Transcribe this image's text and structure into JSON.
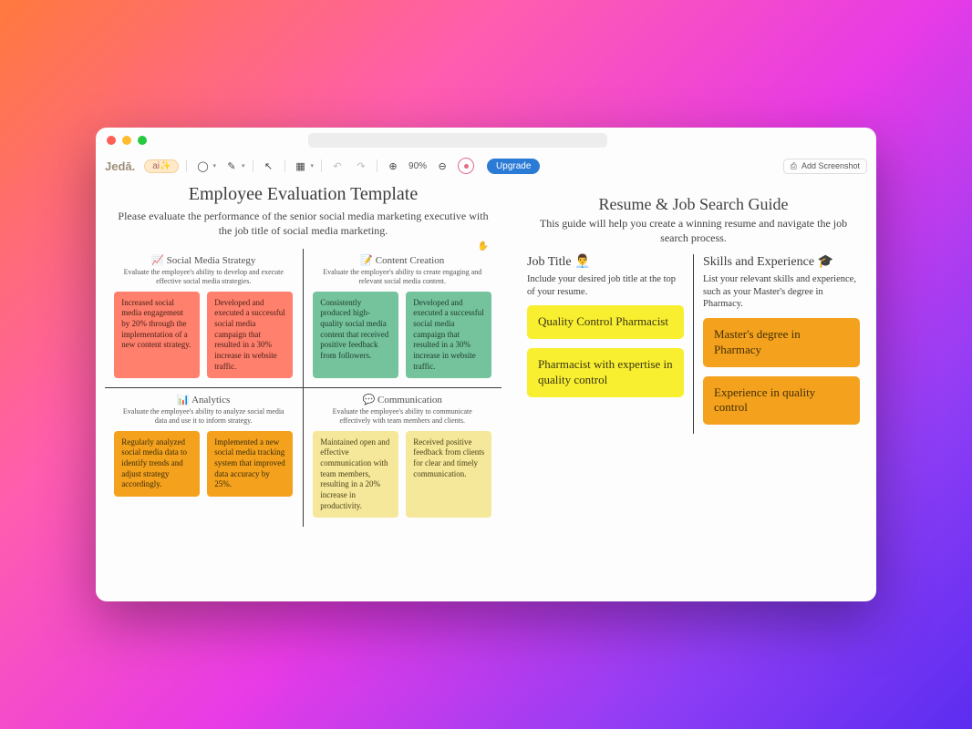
{
  "toolbar": {
    "logo": "Jedā.",
    "ai_label": "ai✨",
    "zoom": "90%",
    "upgrade": "Upgrade",
    "add_screenshot": "Add Screenshot"
  },
  "left": {
    "title": "Employee Evaluation Template",
    "subtitle": "Please evaluate the performance of the senior social media marketing executive with the job title of social media marketing.",
    "quads": [
      {
        "icon": "📈",
        "title": "Social Media Strategy",
        "sub": "Evaluate the employee's ability to develop and execute effective social media strategies.",
        "cards": [
          "Increased social media engagement by 20% through the implementation of a new content strategy.",
          "Developed and executed a successful social media campaign that resulted in a 30% increase in website traffic."
        ],
        "color": "peach"
      },
      {
        "icon": "📝",
        "title": "Content Creation",
        "sub": "Evaluate the employee's ability to create engaging and relevant social media content.",
        "cards": [
          "Consistently produced high-quality social media content that received positive feedback from followers.",
          "Developed and executed a successful social media campaign that resulted in a 30% increase in website traffic."
        ],
        "color": "sage"
      },
      {
        "icon": "📊",
        "title": "Analytics",
        "sub": "Evaluate the employee's ability to analyze social media data and use it to inform strategy.",
        "cards": [
          "Regularly analyzed social media data to identify trends and adjust strategy accordingly.",
          "Implemented a new social media tracking system that improved data accuracy by 25%."
        ],
        "color": "orange"
      },
      {
        "icon": "💬",
        "title": "Communication",
        "sub": "Evaluate the employee's ability to communicate effectively with team members and clients.",
        "cards": [
          "Maintained open and effective communication with team members, resulting in a 20% increase in productivity.",
          "Received positive feedback from clients for clear and timely communication."
        ],
        "color": "cream"
      }
    ]
  },
  "right": {
    "title": "Resume & Job Search Guide",
    "subtitle": "This guide will help you create a winning resume and navigate the job search process.",
    "cols": [
      {
        "title": "Job Title 👨‍💼",
        "desc": "Include your desired job title at the top of your resume.",
        "cards": [
          "Quality Control Pharmacist",
          "Pharmacist with expertise in quality control"
        ],
        "color": "yellow"
      },
      {
        "title": "Skills and Experience 🎓",
        "desc": "List your relevant skills and experience, such as your Master's degree in Pharmacy.",
        "cards": [
          "Master's degree in Pharmacy",
          "Experience in quality control"
        ],
        "color": "orange2"
      }
    ]
  }
}
